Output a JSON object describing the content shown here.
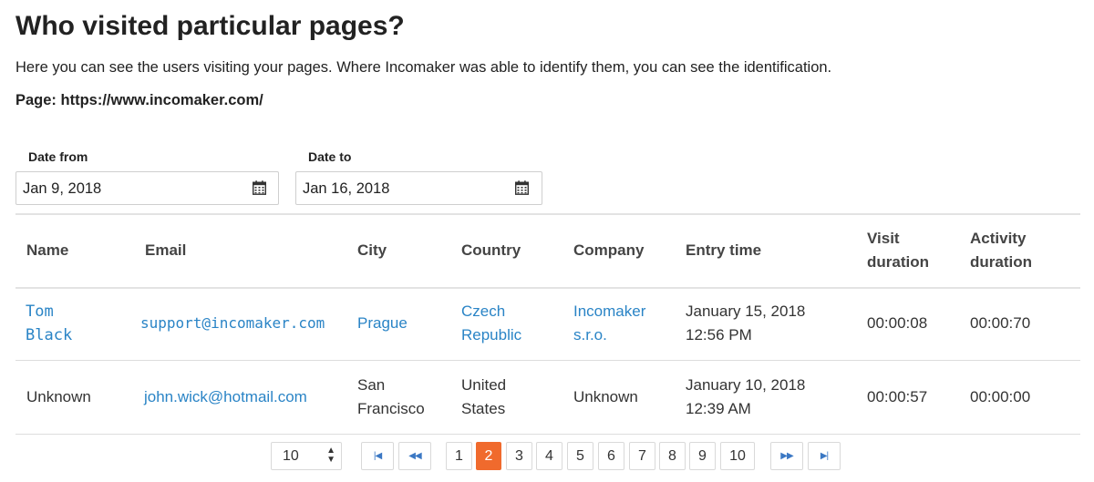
{
  "header": {
    "title": "Who visited particular pages?",
    "description": "Here you can see the users visiting your pages. Where Incomaker was able to identify them, you can see the identification.",
    "page_line": "Page: https://www.incomaker.com/"
  },
  "filters": {
    "date_from_label": "Date from",
    "date_from_value": "Jan 9, 2018",
    "date_to_label": "Date to",
    "date_to_value": "Jan 16, 2018",
    "icon": "calendar-icon"
  },
  "table": {
    "columns": {
      "name": "Name",
      "email": "Email",
      "city": "City",
      "country": "Country",
      "company": "Company",
      "entry_time": "Entry time",
      "visit_duration_1": "Visit",
      "visit_duration_2": "duration",
      "activity_duration_1": "Activity",
      "activity_duration_2": "duration"
    },
    "rows": [
      {
        "name_1": "Tom",
        "name_2": "Black",
        "email": "support@incomaker.com",
        "city": "Prague",
        "country_1": "Czech",
        "country_2": "Republic",
        "company_1": "Incomaker",
        "company_2": "s.r.o.",
        "entry_1": "January 15, 2018",
        "entry_2": "12:56 PM",
        "visit": "00:00:08",
        "activity": "00:00:70"
      },
      {
        "name": "Unknown",
        "email": "john.wick@hotmail.com",
        "city_1": "San",
        "city_2": "Francisco",
        "country_1": "United",
        "country_2": "States",
        "company": "Unknown",
        "entry_1": "January 10, 2018",
        "entry_2": "12:39 AM",
        "visit": "00:00:57",
        "activity": "00:00:00"
      }
    ]
  },
  "pagination": {
    "page_size": "10",
    "pages": [
      "1",
      "2",
      "3",
      "4",
      "5",
      "6",
      "7",
      "8",
      "9",
      "10"
    ],
    "current": "2",
    "icons": [
      "first-page-icon",
      "previous-page-icon",
      "next-page-icon",
      "last-page-icon"
    ],
    "accent": "#f06a2d",
    "link_color": "#2a84c6"
  }
}
